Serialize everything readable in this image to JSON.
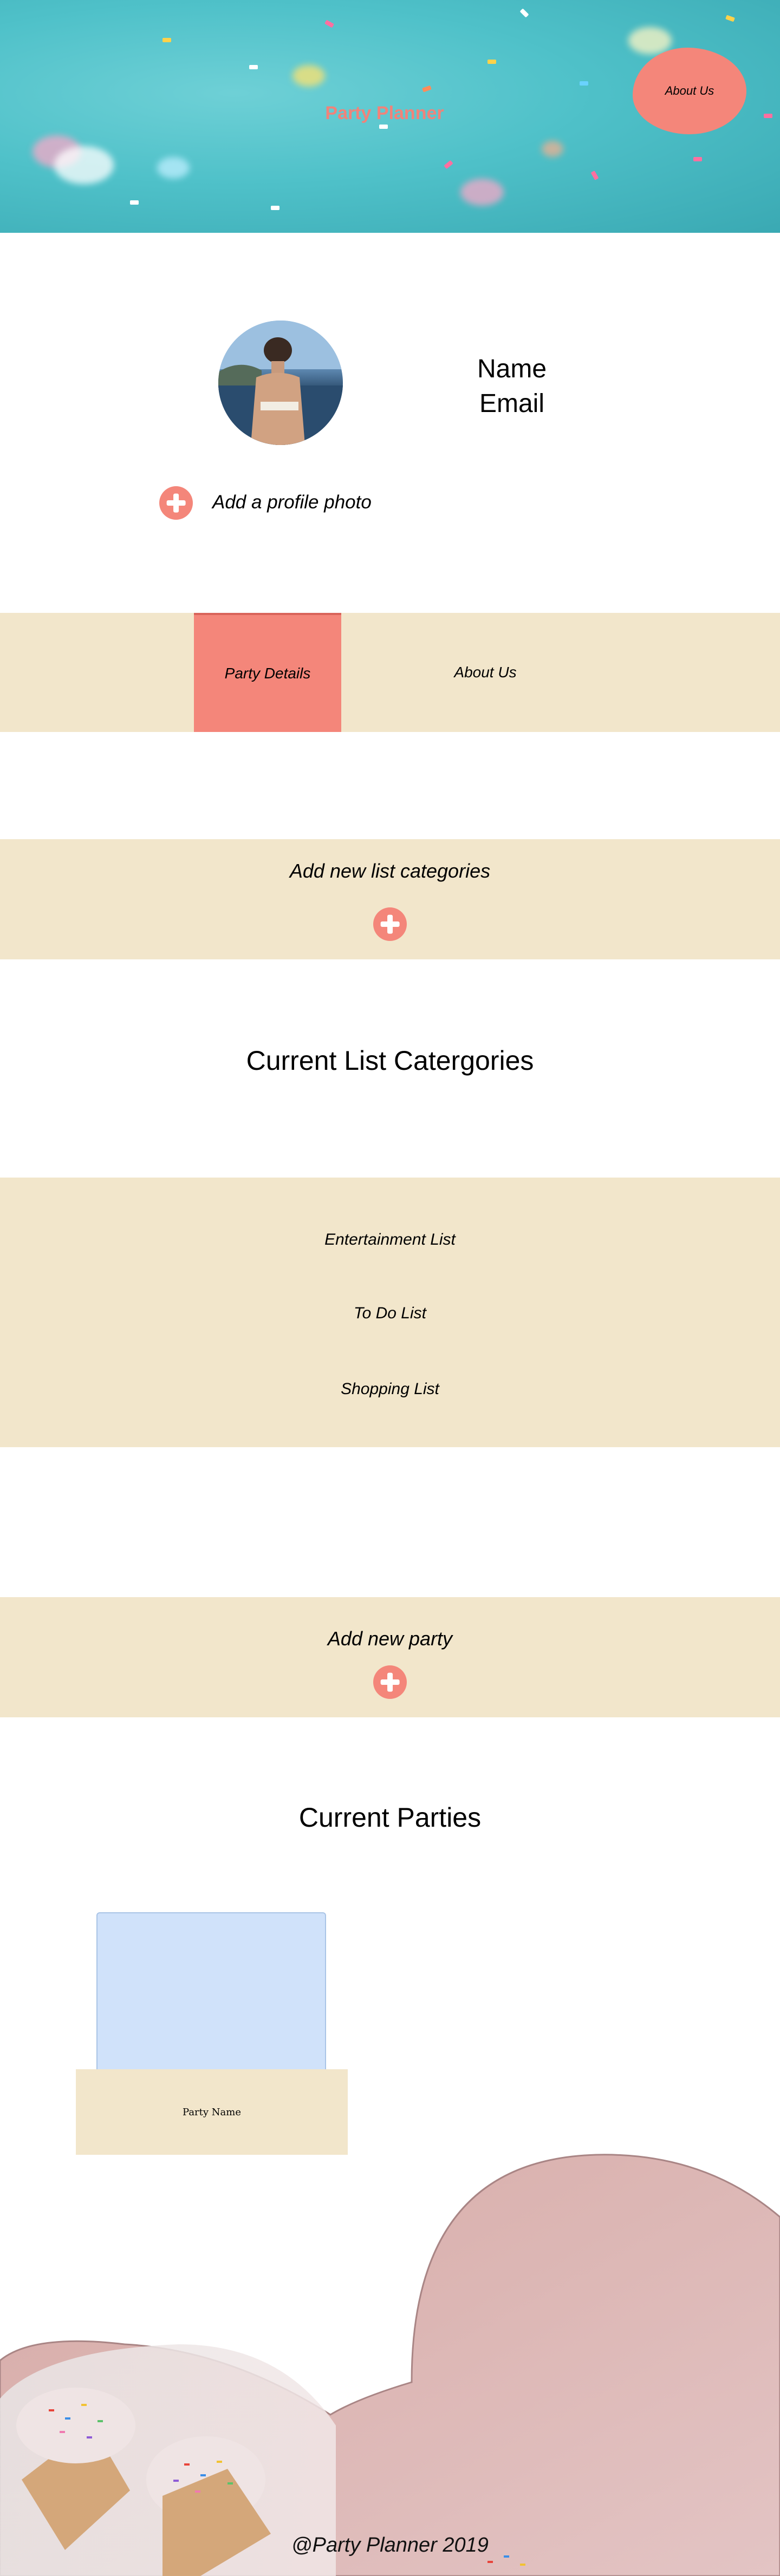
{
  "hero": {
    "title": "Party Planner",
    "about_button": "About Us"
  },
  "profile": {
    "name_label": "Name",
    "email_label": "Email",
    "add_photo_label": "Add a profile photo"
  },
  "nav": {
    "tabs": [
      {
        "label": "Party Details",
        "active": true
      },
      {
        "label": "About Us",
        "active": false
      }
    ]
  },
  "categories": {
    "add_label": "Add new list categories",
    "heading": "Current List Catergories",
    "items": [
      "Entertainment List",
      "To Do List",
      "Shopping List"
    ]
  },
  "parties": {
    "add_label": "Add new party",
    "heading": "Current Parties",
    "cards": [
      {
        "name": "Party Name"
      }
    ]
  },
  "footer": {
    "text": "@Party Planner 2019"
  },
  "colors": {
    "accent": "#f4867a",
    "band": "#f2e6cb",
    "hero": "#4fc1c9"
  }
}
